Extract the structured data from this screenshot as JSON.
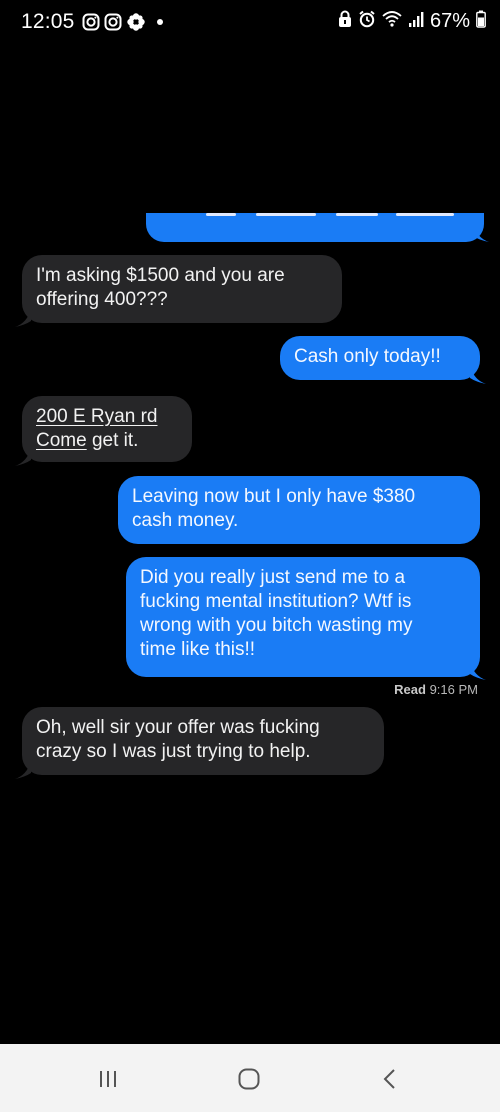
{
  "status_bar": {
    "time": "12:05",
    "battery": "67%",
    "left_icons": [
      "instagram-icon",
      "instagram-icon",
      "flower-icon",
      "dot-icon"
    ],
    "right_icons": [
      "lock-icon",
      "alarm-icon",
      "wifi-icon",
      "signal-icon",
      "battery-icon"
    ]
  },
  "conversation": {
    "messages": [
      {
        "direction": "sent",
        "text": "",
        "partial": true
      },
      {
        "direction": "received",
        "text": "I'm asking $1500 and you are\noffering 400???"
      },
      {
        "direction": "sent",
        "text": "Cash only today!!"
      },
      {
        "direction": "received",
        "line1": "200 E Ryan rd",
        "line2_link": "Come",
        "line2_rest": " get it."
      },
      {
        "direction": "sent",
        "text": "Leaving now but I only have $380\ncash money."
      },
      {
        "direction": "sent",
        "text": "Did you really just send me to a\nfucking mental institution? Wtf is\nwrong with you bitch wasting my\ntime like this!!"
      },
      {
        "direction": "received",
        "text": "Oh, well sir your offer was fucking\ncrazy so I was just trying to help."
      }
    ],
    "read_receipt_label": "Read",
    "read_receipt_time": "9:16 PM"
  },
  "nav_bar": {
    "buttons": [
      "recent-apps-icon",
      "home-icon",
      "back-icon"
    ]
  },
  "colors": {
    "background": "#000000",
    "sent_bubble": "#1a7cf5",
    "received_bubble": "#262628",
    "nav_bar": "#f3f3f3"
  }
}
